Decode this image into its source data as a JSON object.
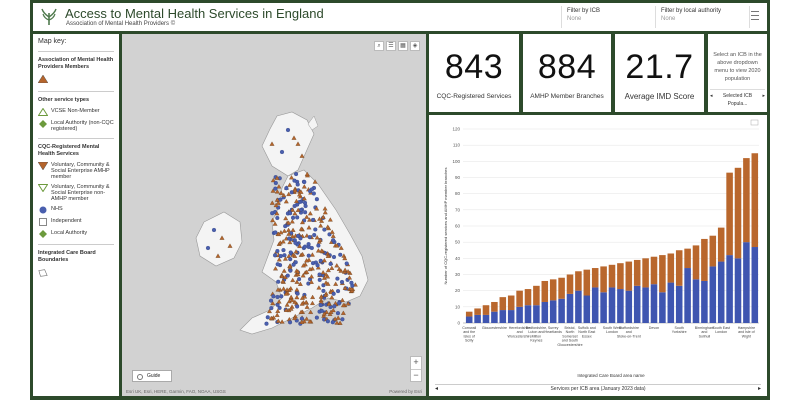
{
  "header": {
    "title": "Access to Mental Health Services in England",
    "subtitle": "Association of Mental Health Providers ©",
    "filters": [
      {
        "label": "Filter by ICB",
        "value": "None"
      },
      {
        "label": "Filter by local authority",
        "value": "None"
      }
    ]
  },
  "legend": {
    "title": "Map key:",
    "sections": {
      "members": "Association of Mental Health Providers Members",
      "other": "Other service types",
      "cqc": "CQC-Registered Mental Health Services",
      "icb": "Integrated Care Board Boundaries"
    },
    "items": {
      "vcse_non_member": "VCSE Non-Member",
      "local_authority_non_cqc": "Local Authority (non-CQC registered)",
      "vcse_amhp_member": "Voluntary, Community & Social Enterprise AMHP member",
      "vcse_non_amhp_member": "Voluntary, Community & Social Enterprise non-AMHP member",
      "nhs": "NHS",
      "independent": "Independent",
      "local_authority": "Local Authority"
    },
    "colors": {
      "member": "#b5652c",
      "nhs": "#4a5fae",
      "green": "#6c9a3c"
    }
  },
  "map": {
    "guide_label": "Guide",
    "attribution": "Esri UK, Esri, HERE, Garmin, FAO, NOAA, USGS",
    "powered_by": "Powered by Esri",
    "tools": [
      "search-icon",
      "list-icon",
      "grid-icon",
      "layers-icon"
    ]
  },
  "kpis": [
    {
      "value": "843",
      "label": "CQC-Registered Services"
    },
    {
      "value": "884",
      "label": "AMHP Member Branches"
    },
    {
      "value": "21.7",
      "label": "Average IMD Score"
    }
  ],
  "side_card": {
    "text": "Select an ICB in the above dropdown menu to view 2020 population",
    "nav_label": "Selected ICB Popula..."
  },
  "chart_data": {
    "type": "bar",
    "stacked": true,
    "ylim": [
      0,
      120
    ],
    "yticks": [
      0,
      10,
      20,
      30,
      40,
      50,
      60,
      70,
      80,
      90,
      100,
      110,
      120
    ],
    "ylabel": "Number of CQC-registered services and AMHP member branches",
    "xlabel": "Integrated Care Board area name",
    "colors": [
      "#3f55b0",
      "#b9672d"
    ],
    "categories": [
      "Cornwall and the Isles of Scilly",
      "",
      "",
      "Gloucestershire",
      "",
      "",
      "Herefordshire and Worcestershire",
      "",
      "Bedfordshire, Luton and Milton Keynes",
      "",
      "Surrey Heartlands",
      "",
      "Bristol, North Somerset and South Gloucestershire",
      "",
      "Suffolk and North East Essex",
      "",
      "",
      "South West London",
      "",
      "Staffordshire and Stoke-on-Trent",
      "",
      "",
      "Devon",
      "",
      "",
      "South Yorkshire",
      "",
      "",
      "Birmingham and Solihull",
      "",
      "South East London",
      "",
      "",
      "Hampshire and Isle of Wight",
      ""
    ],
    "series": [
      {
        "values": [
          4,
          5,
          5,
          7,
          8,
          8,
          10,
          11,
          11,
          13,
          14,
          15,
          18,
          20,
          17,
          22,
          19,
          22,
          21,
          20,
          23,
          22,
          24,
          19,
          25,
          23,
          34,
          27,
          26,
          35,
          38,
          42,
          40,
          50,
          47
        ]
      },
      {
        "values": [
          3,
          4,
          6,
          6,
          8,
          9,
          10,
          10,
          12,
          13,
          13,
          13,
          12,
          12,
          16,
          12,
          16,
          14,
          16,
          18,
          16,
          18,
          17,
          23,
          18,
          22,
          12,
          21,
          26,
          19,
          21,
          51,
          56,
          52,
          58
        ]
      }
    ],
    "footer": "Services per ICB area (January 2023 data)"
  }
}
